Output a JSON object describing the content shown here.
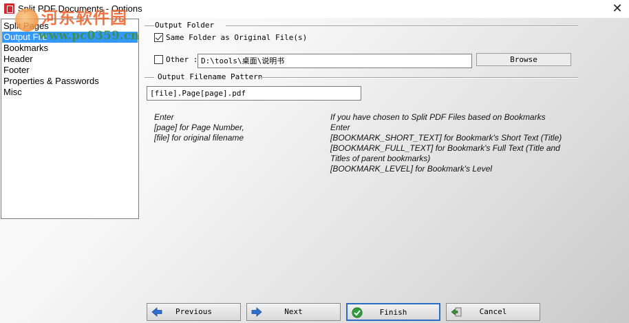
{
  "window": {
    "title": "Split PDF Documents - Options",
    "close_glyph": "✕"
  },
  "watermark": {
    "cn": "河东软件园",
    "url": "www.pc0359.cn"
  },
  "sidebar": {
    "items": [
      {
        "label": "Split Pages"
      },
      {
        "label": "Output File"
      },
      {
        "label": "Bookmarks"
      },
      {
        "label": "Header"
      },
      {
        "label": "Footer"
      },
      {
        "label": "Properties & Passwords"
      },
      {
        "label": "Misc"
      }
    ],
    "selected": "Output File"
  },
  "output_folder": {
    "group_label": "Output Folder",
    "same_folder_label": "Same Folder as Original File(s)",
    "same_folder_checked": true,
    "other_label": "Other :",
    "other_checked": false,
    "path_value": "D:\\tools\\桌面\\说明书",
    "browse_label": "Browse"
  },
  "filename_pattern": {
    "group_label": "Output Filename Pattern",
    "value": "[file].Page[page].pdf"
  },
  "help": {
    "left": [
      "Enter",
      "[page] for Page Number,",
      "[file] for original filename"
    ],
    "right": [
      "If you have chosen to Split PDF Files based on Bookmarks",
      "Enter",
      "[BOOKMARK_SHORT_TEXT] for Bookmark's Short Text (Title)",
      "[BOOKMARK_FULL_TEXT] for Bookmark's Full Text (Title and",
      "Titles of parent bookmarks)",
      "[BOOKMARK_LEVEL] for Bookmark's Level"
    ]
  },
  "nav": {
    "previous_label": "Previous",
    "next_label": "Next",
    "finish_label": "Finish",
    "cancel_label": "Cancel"
  },
  "colors": {
    "selection": "#3399ff",
    "arrow": "#2e6fd0",
    "finish_icon": "#2e9e3a",
    "cancel_icon": "#3a8c3a",
    "app_icon": "#d9262c"
  }
}
